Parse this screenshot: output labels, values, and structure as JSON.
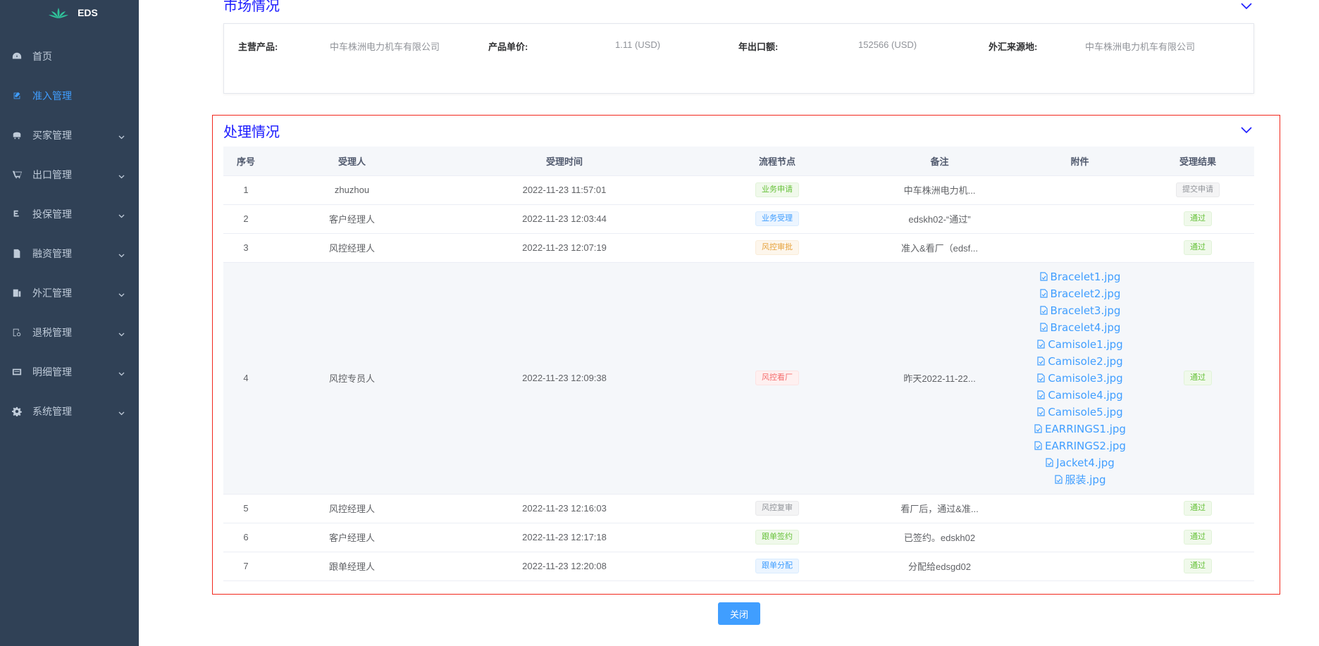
{
  "app": {
    "logo_text": "EDS"
  },
  "sidebar": {
    "items": [
      {
        "label": "首页",
        "icon": "dashboard-icon",
        "has_children": false,
        "active": false
      },
      {
        "label": "准入管理",
        "icon": "edit-icon",
        "has_children": false,
        "active": true
      },
      {
        "label": "买家管理",
        "icon": "buyer-icon",
        "has_children": true,
        "active": false
      },
      {
        "label": "出口管理",
        "icon": "cart-icon",
        "has_children": true,
        "active": false
      },
      {
        "label": "投保管理",
        "icon": "insurance-icon",
        "has_children": true,
        "active": false
      },
      {
        "label": "融资管理",
        "icon": "document-icon",
        "has_children": true,
        "active": false
      },
      {
        "label": "外汇管理",
        "icon": "exchange-icon",
        "has_children": true,
        "active": false
      },
      {
        "label": "退税管理",
        "icon": "tax-icon",
        "has_children": true,
        "active": false
      },
      {
        "label": "明细管理",
        "icon": "detail-icon",
        "has_children": true,
        "active": false
      },
      {
        "label": "系统管理",
        "icon": "gear-icon",
        "has_children": true,
        "active": false
      }
    ]
  },
  "market": {
    "title": "市场情况",
    "fields": [
      {
        "label": "主营产品:",
        "value": "中车株洲电力机车有限公司"
      },
      {
        "label": "产品单价:",
        "value": "1.11 (USD)"
      },
      {
        "label": "年出口额:",
        "value": "152566 (USD)"
      },
      {
        "label": "外汇来源地:",
        "value": "中车株洲电力机车有限公司"
      }
    ]
  },
  "process": {
    "title": "处理情况",
    "columns": [
      "序号",
      "受理人",
      "受理时间",
      "流程节点",
      "备注",
      "附件",
      "受理结果"
    ],
    "rows": [
      {
        "no": "1",
        "handler": "zhuzhou",
        "time": "2022-11-23 11:57:01",
        "node": "业务申请",
        "node_color": "green",
        "remark": "中车株洲电力机...",
        "attachments": [],
        "result": "提交申请",
        "result_color": "gray"
      },
      {
        "no": "2",
        "handler": "客户经理人",
        "time": "2022-11-23 12:03:44",
        "node": "业务受理",
        "node_color": "blue",
        "remark": "edskh02-“通过”",
        "attachments": [],
        "result": "通过",
        "result_color": "green"
      },
      {
        "no": "3",
        "handler": "风控经理人",
        "time": "2022-11-23 12:07:19",
        "node": "风控审批",
        "node_color": "orange",
        "remark": "准入&看厂（edsf...",
        "attachments": [],
        "result": "通过",
        "result_color": "green"
      },
      {
        "no": "4",
        "handler": "风控专员人",
        "time": "2022-11-23 12:09:38",
        "node": "风控看厂",
        "node_color": "red",
        "remark": "昨天2022-11-22...",
        "attachments": [
          "Bracelet1.jpg",
          "Bracelet2.jpg",
          "Bracelet3.jpg",
          "Bracelet4.jpg",
          "Camisole1.jpg",
          "Camisole2.jpg",
          "Camisole3.jpg",
          "Camisole4.jpg",
          "Camisole5.jpg",
          "EARRINGS1.jpg",
          "EARRINGS2.jpg",
          "Jacket4.jpg",
          "服装.jpg"
        ],
        "result": "通过",
        "result_color": "green"
      },
      {
        "no": "5",
        "handler": "风控经理人",
        "time": "2022-11-23 12:16:03",
        "node": "风控复审",
        "node_color": "gray",
        "remark": "看厂后，通过&准...",
        "attachments": [],
        "result": "通过",
        "result_color": "green"
      },
      {
        "no": "6",
        "handler": "客户经理人",
        "time": "2022-11-23 12:17:18",
        "node": "跟单签约",
        "node_color": "green",
        "remark": "已签约。edskh02",
        "attachments": [],
        "result": "通过",
        "result_color": "green"
      },
      {
        "no": "7",
        "handler": "跟单经理人",
        "time": "2022-11-23 12:20:08",
        "node": "跟单分配",
        "node_color": "blue",
        "remark": "分配给edsgd02",
        "attachments": [],
        "result": "通过",
        "result_color": "green"
      }
    ]
  },
  "footer": {
    "close_label": "关闭"
  }
}
